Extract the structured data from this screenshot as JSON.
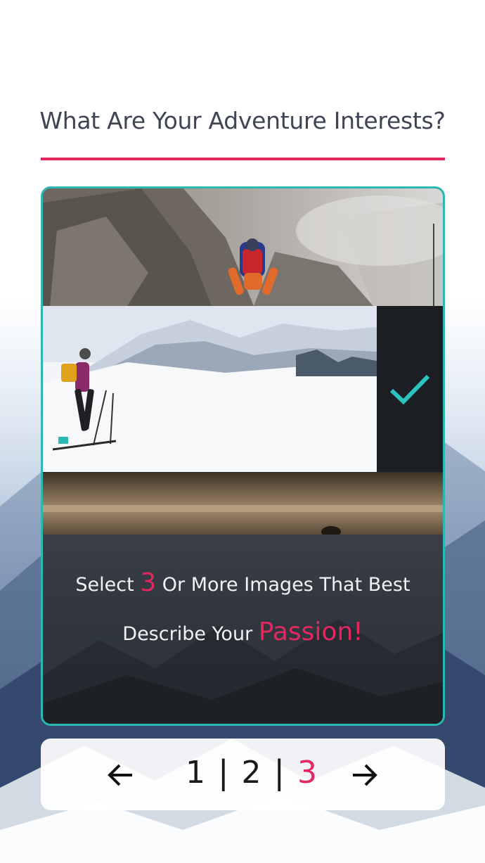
{
  "header": {
    "title": "What Are Your Adventure Interests?"
  },
  "gallery": {
    "tiles": [
      {
        "name": "mountain-climber-image",
        "selected": false
      },
      {
        "name": "ski-touring-image",
        "selected": true
      },
      {
        "name": "misty-lake-kayak-image",
        "selected": false
      }
    ],
    "check_icon": "checkmark-icon"
  },
  "instructions": {
    "line1_prefix": "Select",
    "count": "3",
    "line1_suffix": "Or More Images That Best",
    "line2_prefix": "Describe Your",
    "highlight": "Passion!"
  },
  "pagination": {
    "prev_icon": "arrow-left-icon",
    "next_icon": "arrow-right-icon",
    "pages": [
      "1",
      "2",
      "3"
    ],
    "separator": "|",
    "current": "3"
  },
  "colors": {
    "accent": "#e2285e",
    "card_border": "#2bb7b2",
    "check": "#2bc3bd"
  }
}
